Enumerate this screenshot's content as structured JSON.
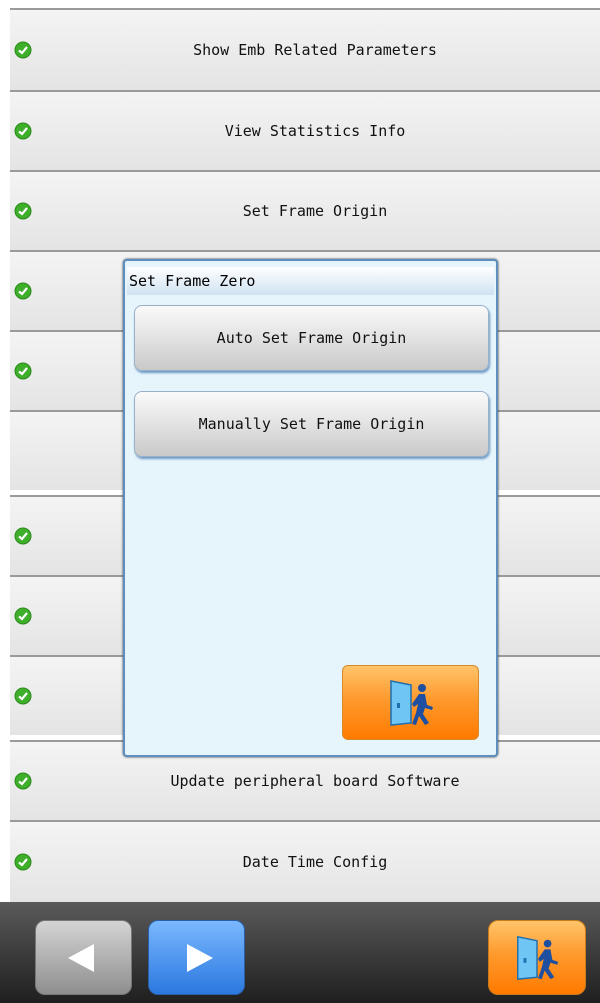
{
  "menu": {
    "items": [
      {
        "label": "Show Emb Related Parameters",
        "check": true
      },
      {
        "label": "View Statistics Info",
        "check": true
      },
      {
        "label": "Set Frame Origin",
        "check": true
      },
      {
        "label": "",
        "check": true
      },
      {
        "label": "",
        "check": true
      },
      {
        "label": "",
        "check": false
      },
      {
        "label": "",
        "check": true
      },
      {
        "label": "",
        "check": true
      },
      {
        "label": "",
        "check": true
      },
      {
        "label": "Update peripheral board Software",
        "check": true
      },
      {
        "label": "Date Time Config",
        "check": true
      }
    ]
  },
  "dialog": {
    "title": "Set Frame Zero",
    "auto_label": "Auto Set Frame Origin",
    "manual_label": "Manually Set Frame Origin",
    "exit_icon": "exit-door-icon"
  },
  "toolbar": {
    "prev_icon": "arrow-left-icon",
    "next_icon": "arrow-right-icon",
    "exit_icon": "exit-door-icon"
  },
  "colors": {
    "check_green": "#3fae2a",
    "accent_orange": "#ff8a00",
    "accent_blue": "#2f7fe4",
    "dialog_bg": "#e6f4fb"
  }
}
